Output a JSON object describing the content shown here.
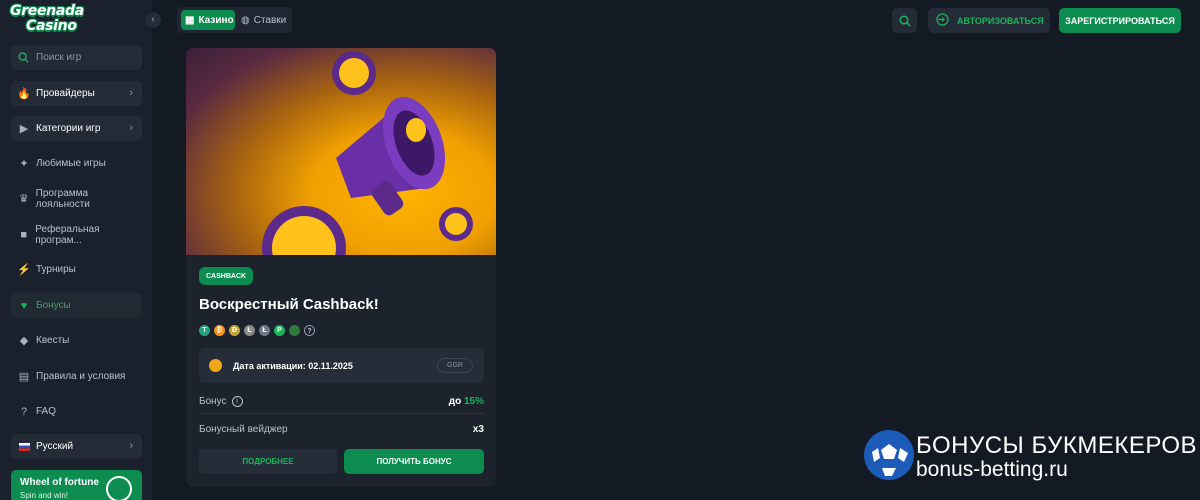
{
  "logo": {
    "line1": "Greenada",
    "line2": "Casino"
  },
  "sidebar": {
    "collapse_icon": "chevron-left-icon",
    "search_placeholder": "Поиск игр",
    "items": [
      {
        "label": "Провайдеры",
        "icon": "flame-icon"
      },
      {
        "label": "Категории игр",
        "icon": "play-icon"
      },
      {
        "label": "Любимые игры",
        "icon": "puzzle-icon"
      },
      {
        "label": "Программа лояльности",
        "icon": "crown-icon"
      },
      {
        "label": "Реферальная програм...",
        "icon": "chat-icon"
      },
      {
        "label": "Турниры",
        "icon": "lightning-icon"
      },
      {
        "label": "Бонусы",
        "icon": "heart-icon"
      },
      {
        "label": "Квесты",
        "icon": "diamond-icon"
      },
      {
        "label": "Правила и условия",
        "icon": "document-icon"
      },
      {
        "label": "FAQ",
        "icon": "help-icon"
      },
      {
        "label": "Русский",
        "icon": "russia-flag-icon"
      }
    ],
    "wheel": {
      "title": "Wheel of fortune",
      "subtitle": "Spin and win!"
    }
  },
  "header": {
    "tabs": [
      {
        "label": "Казино",
        "icon": "casino-icon"
      },
      {
        "label": "Ставки",
        "icon": "ball-icon"
      }
    ],
    "login_label": "АВТОРИЗОВАТЬСЯ",
    "register_label": "ЗАРЕГИСТРИРОВАТЬСЯ"
  },
  "bonus_card": {
    "tag": "CASHBACK",
    "title": "Воскрестный Cashback!",
    "coins": [
      "T",
      "₿",
      "Ð",
      "Ł",
      "Ł",
      "P",
      "",
      "?"
    ],
    "activation_label": "Дата активации: 02.11.2025",
    "badge": "GGR",
    "bonus_label": "Бонус",
    "bonus_value_prefix": "до",
    "bonus_value": "15%",
    "wager_label": "Бонусный вейджер",
    "wager_value": "x3",
    "more_button": "ПОДРОБНЕЕ",
    "get_button": "ПОЛУЧИТЬ БОНУС"
  },
  "watermark": {
    "title": "БОНУСЫ БУКМЕКЕРОВ",
    "url": "bonus-betting.ru"
  },
  "colors": {
    "accent": "#0d8c4f",
    "accent_text": "#1db35c",
    "background": "#141a24",
    "sidebar": "#1a212c"
  }
}
